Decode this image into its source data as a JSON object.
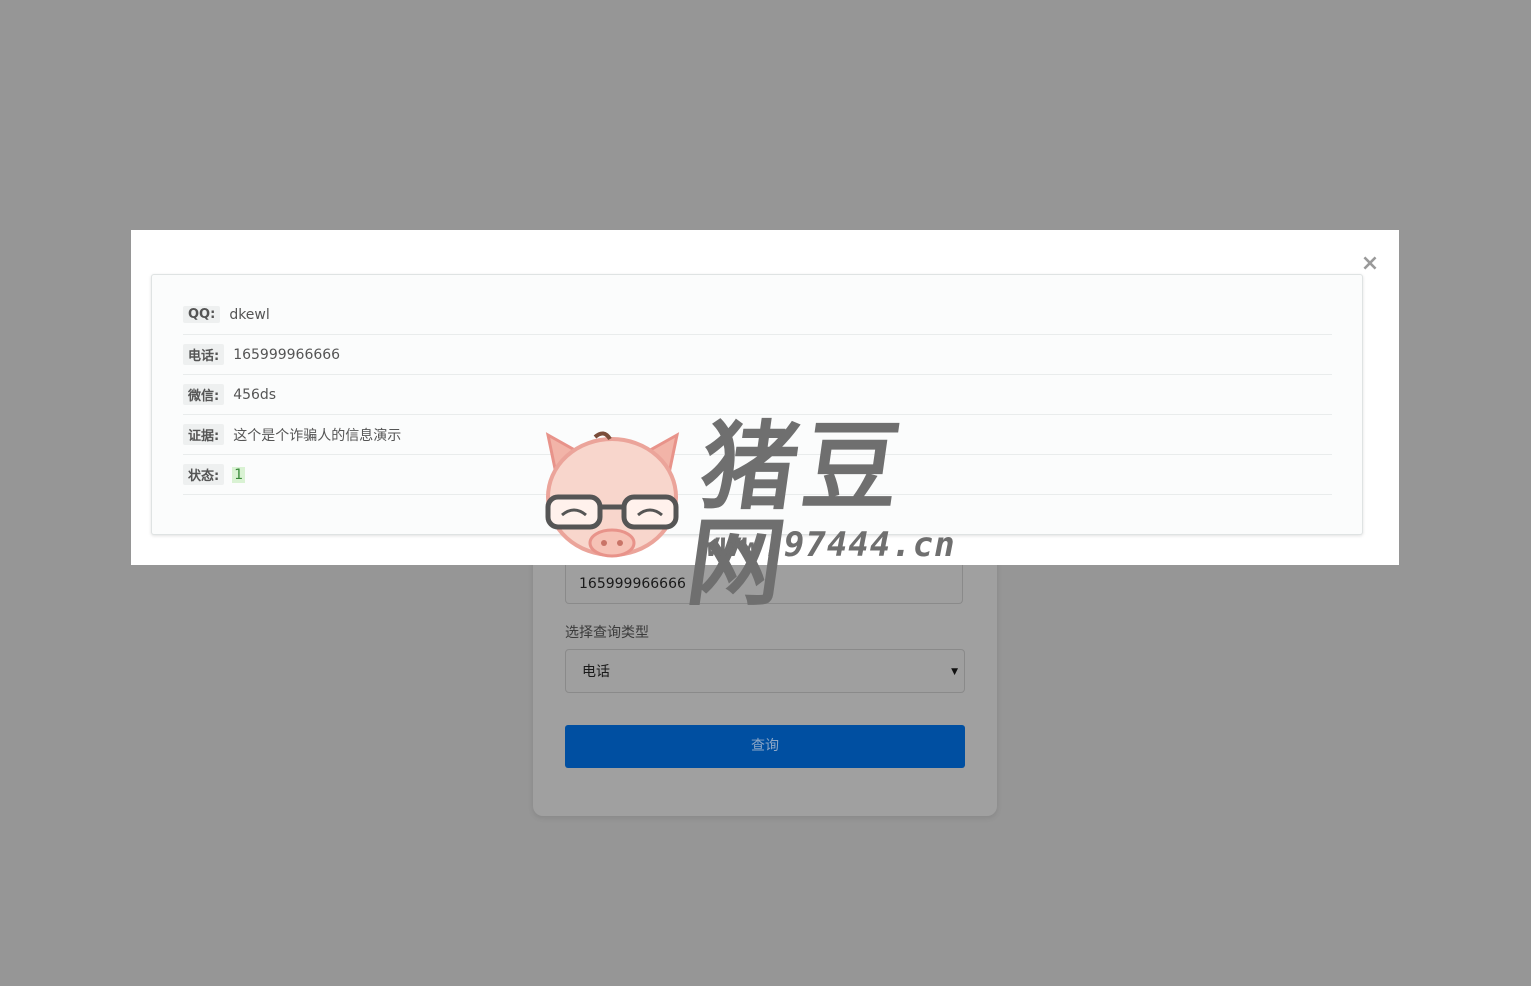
{
  "form": {
    "input_value": "165999966666",
    "type_label": "选择查询类型",
    "type_selected": "电话",
    "submit_label": "查询"
  },
  "modal": {
    "close_glyph": "×",
    "rows": [
      {
        "key": "QQ:",
        "value": "dkewl"
      },
      {
        "key": "电话:",
        "value": "165999966666"
      },
      {
        "key": "微信:",
        "value": "456ds"
      },
      {
        "key": "证据:",
        "value": "这个是个诈骗人的信息演示"
      },
      {
        "key": "状态:",
        "value": "1"
      }
    ]
  },
  "watermark": {
    "logo_text": "猪豆网",
    "url": "www.97444.cn"
  },
  "colors": {
    "overlay": "#969696",
    "primary_button": "#004fa1",
    "status_badge_bg": "#d9f2d3",
    "status_badge_fg": "#3a8a3a"
  }
}
